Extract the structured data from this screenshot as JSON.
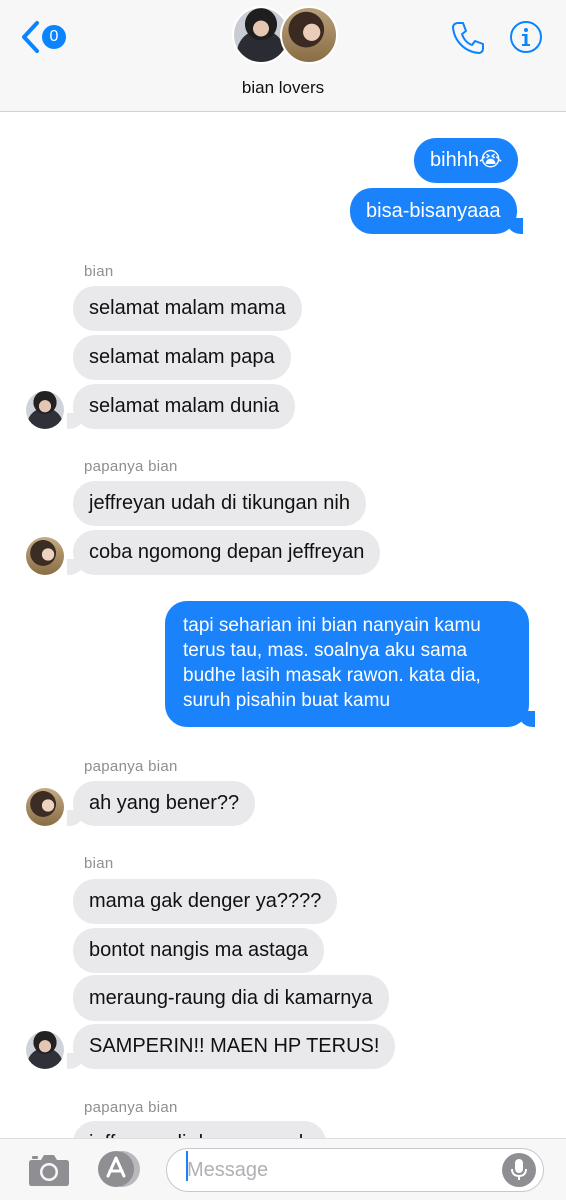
{
  "header": {
    "back_badge": "0",
    "group_name": "bian lovers",
    "accent": "#0a84ff"
  },
  "chat": {
    "senders": {
      "bian": "bian",
      "papa": "papanya bian"
    },
    "messages": [
      {
        "from": "me",
        "text": "bihhh😭"
      },
      {
        "from": "me",
        "text": "bisa-bisanyaaa"
      },
      {
        "from": "bian",
        "text": "selamat malam mama"
      },
      {
        "from": "bian",
        "text": "selamat malam papa"
      },
      {
        "from": "bian",
        "text": "selamat malam dunia"
      },
      {
        "from": "papa",
        "text": "jeffreyan udah di tikungan nih"
      },
      {
        "from": "papa",
        "text": "coba ngomong depan jeffreyan"
      },
      {
        "from": "me",
        "text": "tapi seharian ini bian nanyain kamu terus tau, mas. soalnya aku sama budhe lasih masak rawon. kata dia, suruh pisahin buat kamu"
      },
      {
        "from": "papa",
        "text": "ah yang bener??"
      },
      {
        "from": "bian",
        "text": "mama gak denger ya????"
      },
      {
        "from": "bian",
        "text": "bontot nangis ma astaga"
      },
      {
        "from": "bian",
        "text": "meraung-raung dia di kamarnya"
      },
      {
        "from": "bian",
        "text": "SAMPERIN!! MAEN HP TERUS!"
      },
      {
        "from": "papa",
        "text": "jeffreyan di depan rumah"
      }
    ],
    "sent_color": "#1a82fb",
    "received_color": "#e9e9eb"
  },
  "composer": {
    "placeholder": "Message"
  },
  "icons": [
    "back-chevron-icon",
    "phone-icon",
    "info-icon",
    "camera-icon",
    "app-store-icon",
    "microphone-icon"
  ]
}
